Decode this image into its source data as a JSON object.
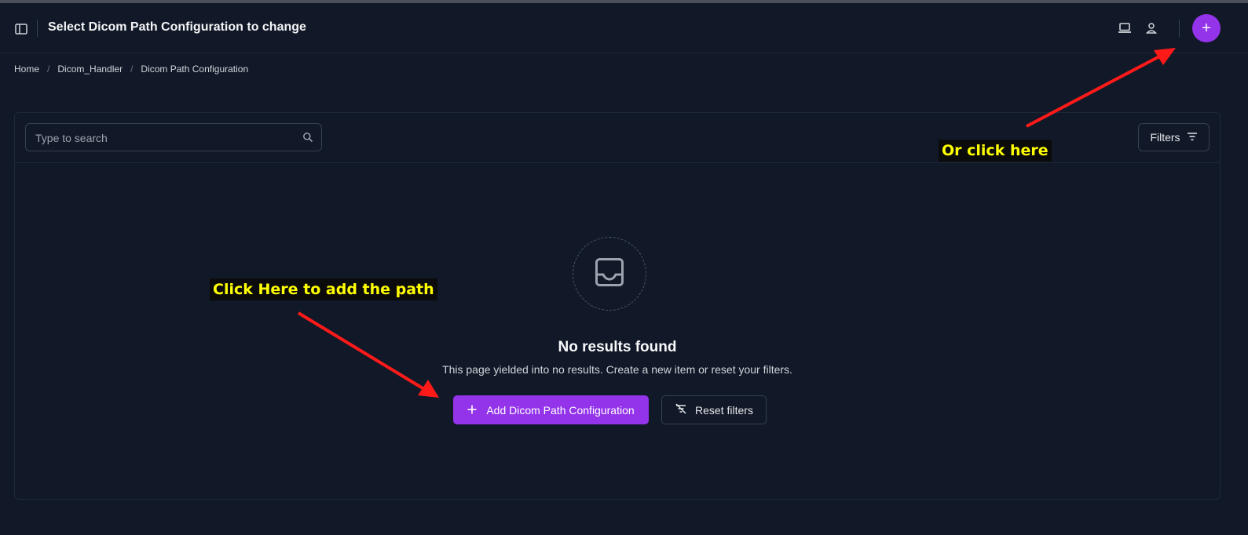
{
  "header": {
    "title": "Select Dicom Path Configuration to change",
    "sidebar_toggle_icon": "sidebar-toggle-icon",
    "theme_icon": "laptop-icon",
    "user_icon": "user-icon",
    "add_icon": "plus-icon",
    "add_glyph": "+"
  },
  "breadcrumb": {
    "items": [
      "Home",
      "Dicom_Handler",
      "Dicom Path Configuration"
    ],
    "separator": "/"
  },
  "toolbar": {
    "search_placeholder": "Type to search",
    "filters_label": "Filters"
  },
  "empty_state": {
    "icon": "inbox-icon",
    "title": "No results found",
    "description": "This page yielded into no results. Create a new item or reset your filters.",
    "add_label": "Add Dicom Path Configuration",
    "reset_label": "Reset filters"
  },
  "annotations": {
    "top_note": "Or click here",
    "main_note": "Click Here to add the path",
    "arrow_color": "#ff1a1a"
  },
  "colors": {
    "background": "#111827",
    "accent": "#9333ea",
    "annotation_text": "#ffff00"
  }
}
